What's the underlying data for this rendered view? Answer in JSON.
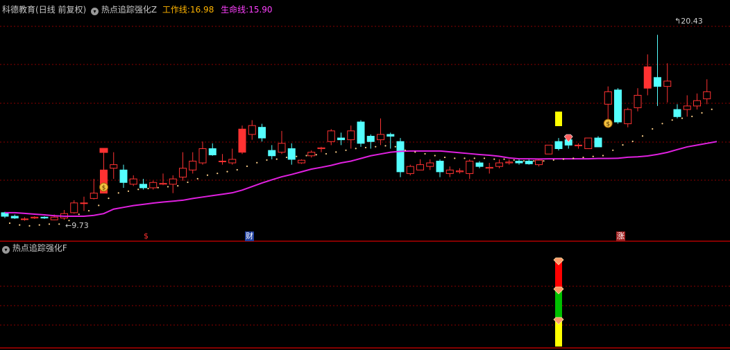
{
  "header": {
    "stock": "科德教育",
    "period": "(日线 前复权)",
    "indicator": "热点追踪强化Z",
    "work_label": "工作线:",
    "work_value": "16.98",
    "life_label": "生命线:",
    "life_value": "15.90"
  },
  "sub_header": {
    "indicator": "热点追踪强化F"
  },
  "markers": {
    "high_label": "20.43",
    "low_label": "9.73",
    "event_labels": [
      "$",
      "财",
      "涨"
    ]
  },
  "colors": {
    "bg": "#000000",
    "up": "#ff3232",
    "down": "#54ffff",
    "life_line": "#e020e0",
    "work_dots": "#ffd08a",
    "grid": "#8b0000",
    "title": "#c0c0c0",
    "work_text": "#ffb400",
    "life_text": "#ff40ff",
    "signal_yellow": "#ffff00"
  },
  "chart_data": [
    {
      "type": "candlestick",
      "ohlc": [
        [
          10.4,
          10.45,
          10.1,
          10.2
        ],
        [
          10.2,
          10.3,
          10.05,
          10.1
        ],
        [
          10.05,
          10.15,
          9.95,
          10.05
        ],
        [
          10.1,
          10.2,
          10.05,
          10.15
        ],
        [
          10.15,
          10.2,
          10.05,
          10.1
        ],
        [
          10.0,
          10.3,
          9.98,
          10.15
        ],
        [
          10.1,
          10.55,
          10.0,
          10.35
        ],
        [
          10.4,
          11.1,
          10.35,
          10.95
        ],
        [
          10.95,
          11.3,
          10.5,
          10.95
        ],
        [
          11.2,
          12.3,
          11.15,
          11.5
        ],
        [
          11.5,
          14.0,
          11.5,
          12.8
        ],
        [
          12.9,
          13.8,
          12.3,
          13.1
        ],
        [
          12.8,
          13.1,
          11.8,
          12.1
        ],
        [
          12.0,
          12.5,
          11.9,
          12.3
        ],
        [
          12.0,
          12.3,
          11.7,
          11.8
        ],
        [
          11.8,
          12.2,
          11.7,
          12.1
        ],
        [
          12.0,
          12.6,
          11.95,
          12.05
        ],
        [
          12.0,
          12.5,
          11.5,
          12.3
        ],
        [
          12.4,
          13.8,
          12.2,
          12.9
        ],
        [
          12.8,
          13.8,
          12.6,
          13.3
        ],
        [
          13.2,
          14.4,
          13.1,
          14.0
        ],
        [
          14.0,
          14.3,
          13.6,
          13.65
        ],
        [
          13.3,
          13.7,
          13.1,
          13.3
        ],
        [
          13.2,
          14.0,
          13.1,
          13.4
        ],
        [
          13.8,
          15.3,
          13.7,
          15.1
        ],
        [
          14.8,
          15.6,
          14.5,
          15.3
        ],
        [
          15.2,
          15.4,
          14.4,
          14.6
        ],
        [
          13.9,
          14.2,
          13.4,
          13.6
        ],
        [
          13.8,
          15.0,
          13.7,
          14.3
        ],
        [
          14.0,
          14.3,
          13.1,
          13.4
        ],
        [
          13.2,
          13.4,
          13.15,
          13.35
        ],
        [
          13.6,
          13.9,
          13.5,
          13.8
        ],
        [
          14.0,
          14.1,
          13.8,
          14.05
        ],
        [
          14.4,
          15.1,
          14.2,
          15.0
        ],
        [
          14.6,
          14.9,
          14.2,
          14.5
        ],
        [
          14.5,
          15.3,
          14.0,
          15.0
        ],
        [
          15.5,
          15.6,
          14.1,
          14.3
        ],
        [
          14.7,
          14.8,
          14.0,
          14.4
        ],
        [
          14.5,
          15.7,
          14.2,
          14.8
        ],
        [
          14.8,
          14.9,
          14.0,
          14.7
        ],
        [
          14.4,
          14.6,
          12.4,
          12.7
        ],
        [
          12.6,
          13.1,
          12.5,
          13.0
        ],
        [
          12.8,
          13.4,
          12.8,
          13.1
        ],
        [
          13.0,
          13.4,
          12.8,
          13.2
        ],
        [
          13.3,
          13.4,
          12.4,
          12.7
        ],
        [
          12.6,
          13.0,
          12.4,
          12.8
        ],
        [
          12.7,
          12.9,
          12.6,
          12.75
        ],
        [
          12.6,
          13.4,
          12.3,
          13.3
        ],
        [
          13.2,
          13.3,
          12.9,
          13.0
        ],
        [
          12.9,
          13.2,
          12.6,
          12.95
        ],
        [
          13.0,
          13.4,
          12.9,
          13.2
        ],
        [
          13.2,
          13.4,
          13.1,
          13.25
        ],
        [
          13.3,
          13.4,
          13.1,
          13.2
        ],
        [
          13.3,
          13.4,
          13.1,
          13.15
        ],
        [
          13.1,
          13.4,
          13.0,
          13.35
        ],
        [
          13.7,
          14.2,
          13.7,
          14.2
        ],
        [
          14.4,
          14.6,
          13.9,
          14.0
        ],
        [
          14.5,
          14.6,
          14.0,
          14.2
        ],
        [
          14.2,
          14.3,
          14.0,
          14.2
        ],
        [
          14.0,
          14.6,
          14.0,
          14.6
        ],
        [
          14.6,
          14.7,
          14.1,
          14.1
        ],
        [
          16.5,
          17.5,
          15.5,
          17.2
        ],
        [
          17.3,
          17.4,
          15.4,
          15.5
        ],
        [
          15.4,
          16.3,
          15.2,
          16.2
        ],
        [
          16.3,
          17.4,
          16.1,
          17.0
        ],
        [
          17.4,
          19.3,
          17.0,
          18.6
        ],
        [
          18.0,
          20.4,
          16.4,
          17.5
        ],
        [
          17.5,
          18.8,
          16.6,
          17.8
        ],
        [
          16.2,
          16.5,
          15.7,
          15.8
        ],
        [
          16.2,
          17.0,
          15.8,
          16.4
        ],
        [
          16.4,
          17.1,
          16.2,
          16.7
        ],
        [
          16.8,
          17.9,
          16.5,
          17.2
        ]
      ],
      "life_line": [
        10.4,
        10.4,
        10.36,
        10.32,
        10.28,
        10.23,
        10.2,
        10.2,
        10.2,
        10.25,
        10.35,
        10.6,
        10.7,
        10.8,
        10.87,
        10.94,
        11.0,
        11.05,
        11.1,
        11.2,
        11.28,
        11.36,
        11.44,
        11.52,
        11.67,
        11.87,
        12.07,
        12.25,
        12.42,
        12.55,
        12.7,
        12.85,
        12.95,
        13.06,
        13.2,
        13.3,
        13.45,
        13.6,
        13.7,
        13.8,
        13.85,
        13.87,
        13.87,
        13.87,
        13.87,
        13.82,
        13.77,
        13.72,
        13.67,
        13.63,
        13.57,
        13.48,
        13.43,
        13.43,
        13.42,
        13.43,
        13.43,
        13.43,
        13.43,
        13.43,
        13.45,
        13.45,
        13.46,
        13.52,
        13.54,
        13.59,
        13.68,
        13.79,
        13.95,
        14.1,
        14.2,
        14.3,
        14.4
      ],
      "work_line": [
        10.2,
        10.1,
        10.05,
        10.1,
        10.15,
        10.15,
        10.35,
        10.7,
        10.9,
        11.2,
        11.6,
        11.9,
        12.0,
        12.1,
        12.15,
        12.2,
        12.25,
        12.3,
        12.5,
        12.7,
        12.9,
        13.0,
        13.1,
        13.2,
        13.4,
        13.6,
        13.75,
        13.8,
        13.9,
        13.95,
        14.0,
        14.05,
        14.1,
        14.2,
        14.3,
        14.4,
        14.45,
        14.5,
        14.55,
        14.5,
        14.3,
        14.2,
        14.1,
        14.0,
        13.9,
        13.85,
        13.85,
        13.85,
        13.85,
        13.8,
        13.8,
        13.75,
        13.7,
        13.7,
        13.7,
        13.75,
        13.8,
        13.85,
        13.9,
        13.95,
        14.0,
        14.3,
        14.6,
        14.8,
        15.1,
        15.5,
        15.8,
        16.0,
        16.1,
        16.2,
        16.4,
        16.6
      ],
      "price_range": [
        9.5,
        21.5
      ],
      "highest": 20.43,
      "lowest": 9.73
    },
    {
      "type": "signal_bar",
      "signal_index": 56,
      "segments": [
        {
          "color": "#ff0000",
          "from": 0.0,
          "to": 0.33
        },
        {
          "color": "#00c000",
          "from": 0.33,
          "to": 0.66
        },
        {
          "color": "#ffff00",
          "from": 0.66,
          "to": 1.0
        }
      ]
    }
  ]
}
